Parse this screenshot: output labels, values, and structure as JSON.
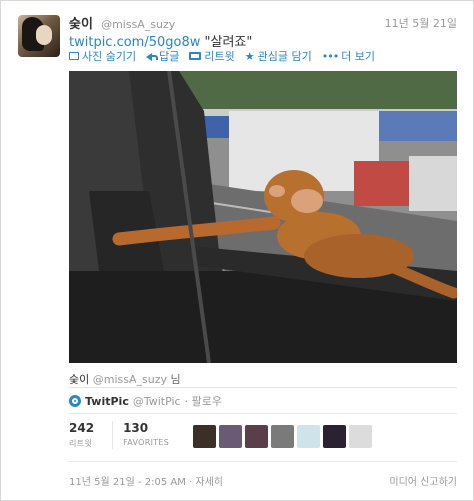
{
  "tweet": {
    "name": "숮이",
    "handle": "@missA_suzy",
    "date": "11년 5월 21일",
    "link": "twitpic.com/50go8w",
    "quote": "\"살려죠\""
  },
  "actions": [
    {
      "label": "사진 숨기기",
      "icon": "photo-icon"
    },
    {
      "label": "답글",
      "icon": "reply-icon"
    },
    {
      "label": "리트윗",
      "icon": "retweet-icon"
    },
    {
      "label": "관심글 담기",
      "icon": "star-icon"
    },
    {
      "label": "더 보기",
      "icon": "more-icon"
    }
  ],
  "attribution": {
    "name": "숮이",
    "handle": "@missA_suzy",
    "suffix": "님"
  },
  "twitpic": {
    "name": "TwitPic",
    "handle": "@TwitPic",
    "follow": "· 팔로우"
  },
  "stats": {
    "retweets": {
      "value": "242",
      "label": "리트윗"
    },
    "favorites": {
      "value": "130",
      "label": "FAVORITES"
    }
  },
  "favoriters": [
    {
      "color": "#3b2f2a"
    },
    {
      "color": "#6a5a73"
    },
    {
      "color": "#5a3f4a"
    },
    {
      "color": "#7a7a7a"
    },
    {
      "color": "#cfe3ea"
    },
    {
      "color": "#2a2230"
    },
    {
      "color": "#dcdcdc"
    }
  ],
  "footer": {
    "timestamp": "11년 5월 21일 - 2:05 AM",
    "details": "· 자세히",
    "report": "미디어 신고하기"
  }
}
